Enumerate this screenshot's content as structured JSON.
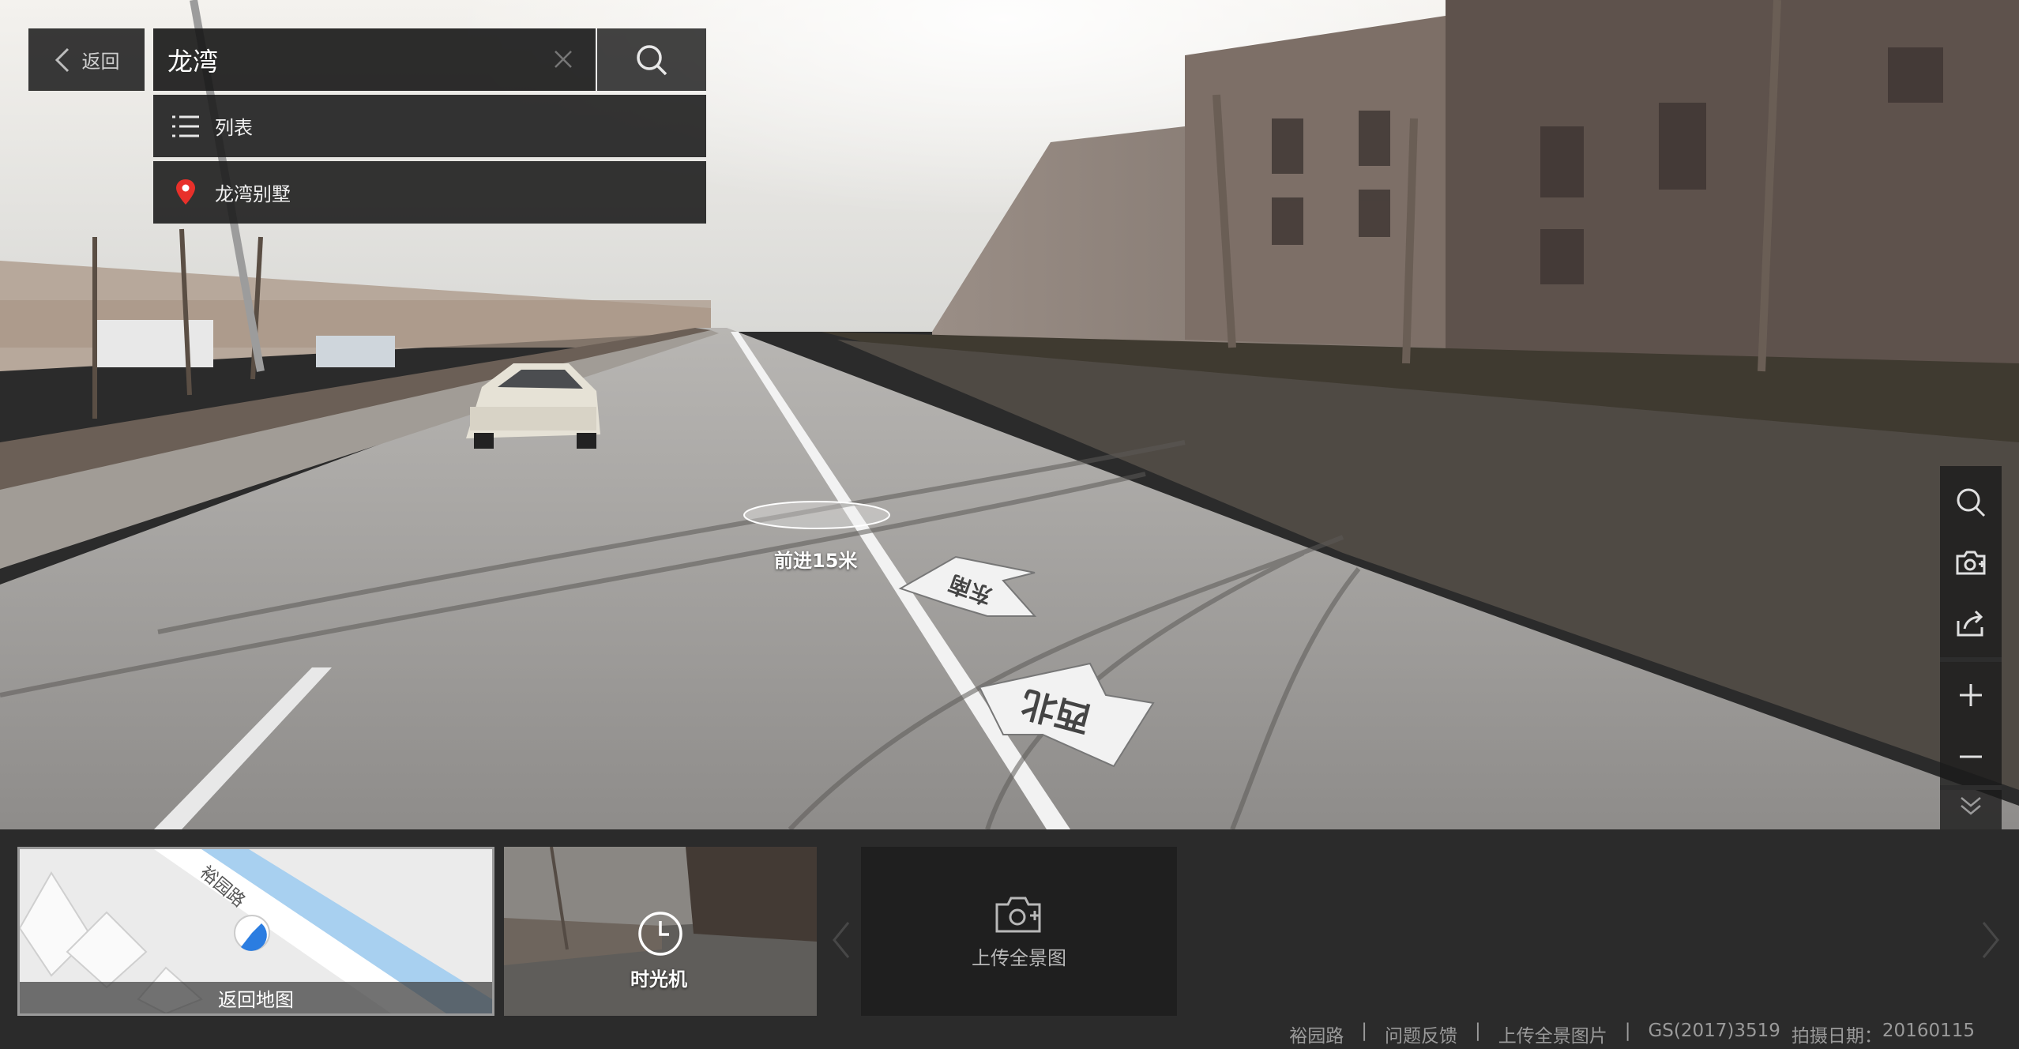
{
  "search": {
    "back_label": "返回",
    "query": "龙湾",
    "list_label": "列表",
    "result_label": "龙湾别墅"
  },
  "scene": {
    "step_label": "前进15米",
    "arrow_forward_label": "东南",
    "arrow_back_label": "西北"
  },
  "toolbar": {
    "icons": [
      "search-icon",
      "camera-add-icon",
      "share-icon",
      "zoom-in-icon",
      "zoom-out-icon",
      "collapse-icon"
    ]
  },
  "bottom": {
    "map_caption": "返回地图",
    "map_road_name": "裕园路",
    "time_machine_label": "时光机",
    "upload_label": "上传全景图"
  },
  "footer": {
    "road": "裕园路",
    "feedback": "问题反馈",
    "upload_photos": "上传全景图片",
    "license": "GS(2017)3519",
    "date_label": "拍摄日期：",
    "date": "20160115"
  },
  "colors": {
    "panel_bg": "#1e1e1e",
    "bottom_bg": "#2b2b2b",
    "marker_red": "#e8302a",
    "map_road_blue": "#a8d0f0",
    "locator_blue": "#2b7de1"
  }
}
